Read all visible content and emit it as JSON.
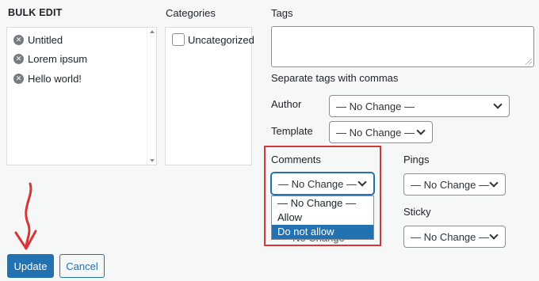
{
  "bulk_edit": {
    "title": "BULK EDIT",
    "posts": [
      "Untitled",
      "Lorem ipsum",
      "Hello world!"
    ]
  },
  "categories": {
    "label": "Categories",
    "items": [
      "Uncategorized"
    ]
  },
  "tags": {
    "label": "Tags",
    "hint": "Separate tags with commas"
  },
  "author": {
    "label": "Author",
    "value": "— No Change —"
  },
  "template": {
    "label": "Template",
    "value": "— No Change —"
  },
  "comments": {
    "label": "Comments",
    "value": "— No Change —",
    "options": [
      "— No Change —",
      "Allow",
      "Do not allow"
    ],
    "highlighted_option": "Do not allow",
    "behind_text": "No Change"
  },
  "pings": {
    "label": "Pings",
    "value": "— No Change —"
  },
  "sticky": {
    "label": "Sticky",
    "value": "— No Change —"
  },
  "buttons": {
    "update": "Update",
    "cancel": "Cancel"
  },
  "colors": {
    "primary": "#2271b1",
    "annotation_red": "#d63638",
    "background": "#f6f7f7"
  }
}
